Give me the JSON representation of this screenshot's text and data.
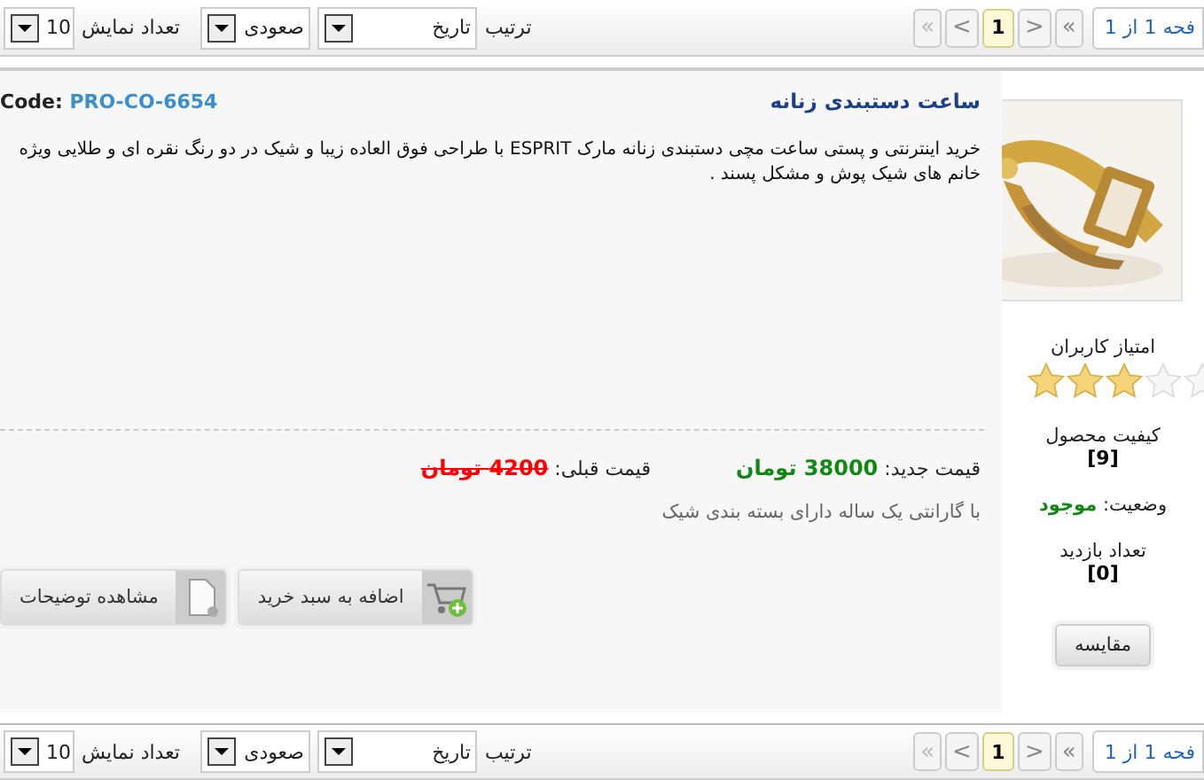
{
  "toolbars": [
    {
      "page_size_label": "تعداد نمایش",
      "page_size": "10",
      "order": "صعودی",
      "sort_label": "ترتیب",
      "sort": "تاریخ",
      "pager": [
        {
          "label": "«",
          "kind": "nav",
          "disabled": false,
          "selected": false
        },
        {
          "label": ">",
          "kind": "nav",
          "disabled": false,
          "selected": false
        },
        {
          "label": "1",
          "kind": "page",
          "disabled": false,
          "selected": true
        },
        {
          "label": "<",
          "kind": "nav",
          "disabled": false,
          "selected": false
        },
        {
          "label": "«",
          "kind": "nav",
          "disabled": true,
          "selected": false
        }
      ],
      "page_info": "فحه 1 از 1"
    },
    {
      "page_size_label": "تعداد نمایش",
      "page_size": "10",
      "order": "صعودی",
      "sort_label": "ترتیب",
      "sort": "تاریخ",
      "pager": [
        {
          "label": "«",
          "kind": "nav",
          "disabled": false,
          "selected": false
        },
        {
          "label": ">",
          "kind": "nav",
          "disabled": false,
          "selected": false
        },
        {
          "label": "1",
          "kind": "page",
          "disabled": false,
          "selected": true
        },
        {
          "label": "<",
          "kind": "nav",
          "disabled": false,
          "selected": false
        },
        {
          "label": "«",
          "kind": "nav",
          "disabled": true,
          "selected": false
        }
      ],
      "page_info": "فحه 1 از 1"
    }
  ],
  "product": {
    "rating_label": "امتیاز کاربران",
    "stars": 3,
    "quality_label": "کیفیت محصول",
    "quality": "[9]",
    "status_label": "وضعیت:",
    "status": "موجود",
    "views_label": "تعداد بازدید",
    "views": "[0]",
    "compare_button": "مقایسه",
    "title": "ساعت دستبندی زنانه",
    "code_label": "Code:",
    "code": "PRO-CO-6654",
    "description": "خرید اینترنتی و پستی ساعت مچی دستبندی زنانه مارک ESPRIT با طراحی فوق العاده زیبا و شیک در دو رنگ نقره ای و طلایی ویژه خانم های شیک پوش و مشکل پسند .",
    "new_price_label": "قیمت جدید:",
    "new_price": "38000 تومان",
    "old_price_label": "قیمت قبلی:",
    "old_price": "4200 تومان",
    "note": "با گارانتی یک ساله دارای بسته بندی شیک",
    "cart_button": "اضافه به سبد خرید",
    "details_button": "مشاهده توضیحات"
  }
}
